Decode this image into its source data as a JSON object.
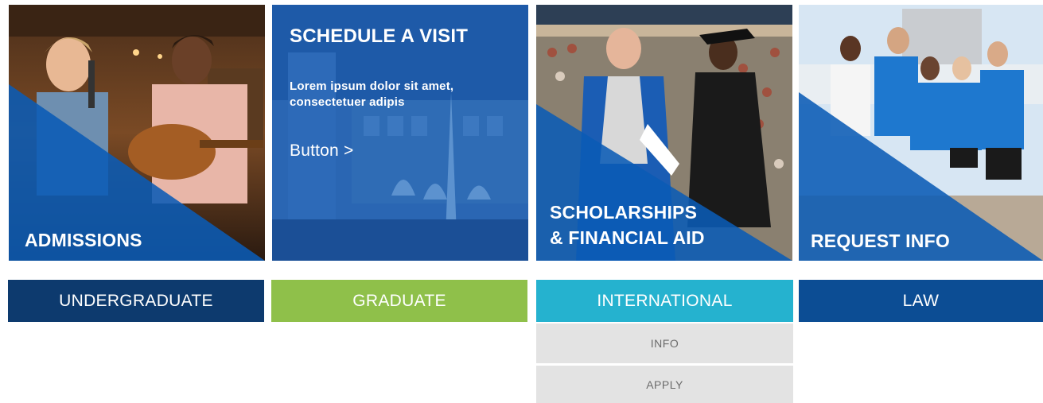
{
  "tiles": {
    "admissions": {
      "title": "ADMISSIONS"
    },
    "visit": {
      "title": "SCHEDULE A VISIT",
      "body": "Lorem ipsum dolor sit amet, consectetuer adipis",
      "button_label": "Button >"
    },
    "scholarships": {
      "title_line1": "SCHOLARSHIPS",
      "title_line2": "& FINANCIAL AID"
    },
    "request": {
      "title": "REQUEST INFO"
    }
  },
  "programs": {
    "undergraduate": "UNDERGRADUATE",
    "graduate": "GRADUATE",
    "international": "INTERNATIONAL",
    "law": "LAW"
  },
  "international_menu": {
    "info": "INFO",
    "apply": "APPLY"
  },
  "colors": {
    "navy": "#0d3a6e",
    "green": "#8fc04a",
    "teal": "#25b2cf",
    "blue": "#0c4d94",
    "overlay_blue": "#0a5bb5",
    "submenu_gray": "#e3e3e3"
  }
}
